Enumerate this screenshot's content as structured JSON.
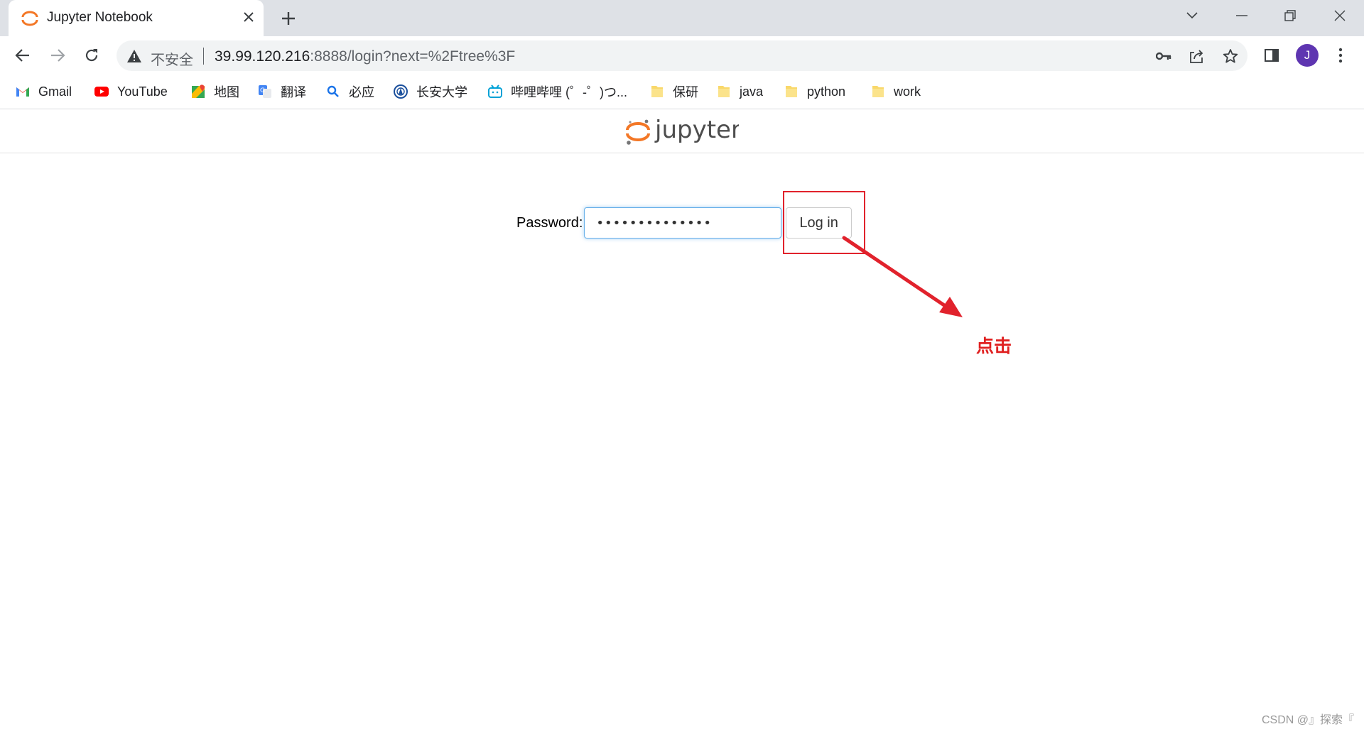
{
  "browser": {
    "tab_title": "Jupyter Notebook",
    "insecure_label": "不安全",
    "url_host": "39.99.120.216",
    "url_rest": ":8888/login?next=%2Ftree%3F",
    "profile_initial": "J",
    "bookmarks": [
      {
        "label": "Gmail",
        "icon": "gmail-icon"
      },
      {
        "label": "YouTube",
        "icon": "youtube-icon"
      },
      {
        "label": "地图",
        "icon": "maps-icon"
      },
      {
        "label": "翻译",
        "icon": "translate-icon"
      },
      {
        "label": "必应",
        "icon": "bing-search-icon"
      },
      {
        "label": "长安大学",
        "icon": "university-icon"
      },
      {
        "label": "哔哩哔哩 (゜-゜)つ...",
        "icon": "bilibili-icon"
      },
      {
        "label": "保研",
        "icon": "folder-icon"
      },
      {
        "label": "java",
        "icon": "folder-icon"
      },
      {
        "label": "python",
        "icon": "folder-icon"
      },
      {
        "label": "work",
        "icon": "folder-icon"
      }
    ]
  },
  "page": {
    "logo_text": "jupyter",
    "password_label": "Password:",
    "password_value": "••••••••••••••",
    "login_button": "Log in"
  },
  "annotation": {
    "text": "点击",
    "color": "#e02020"
  },
  "watermark": "CSDN @』探索『"
}
